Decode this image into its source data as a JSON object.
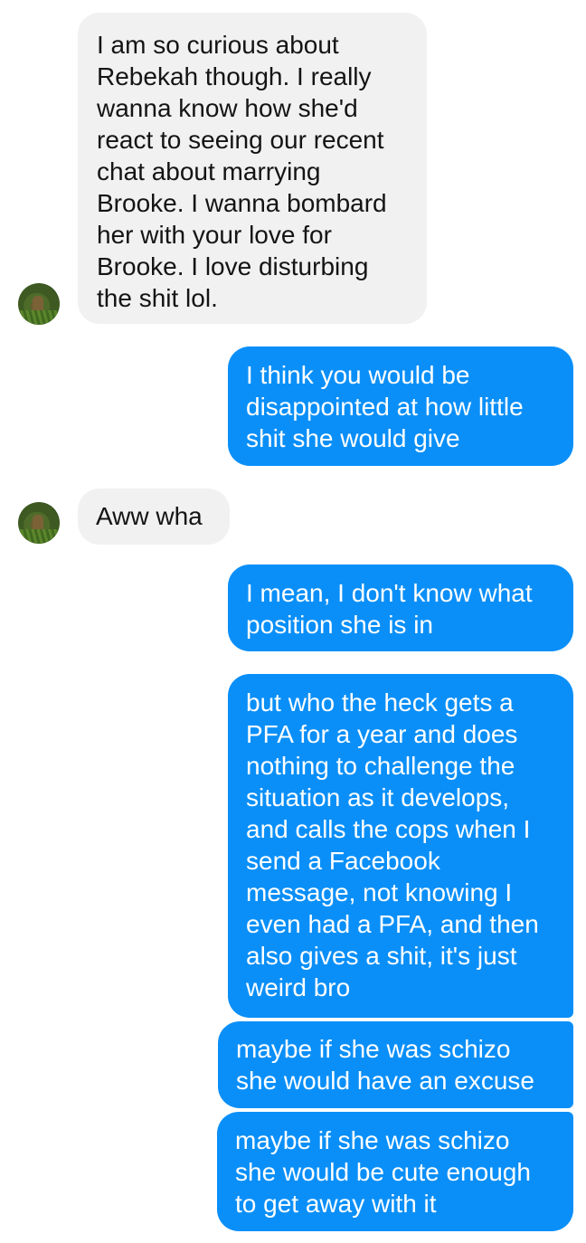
{
  "colors": {
    "incoming_bubble": "#f1f1f1",
    "outgoing_bubble": "#0a8ff8",
    "incoming_text": "#141414",
    "outgoing_text": "#ffffff"
  },
  "contact": {
    "avatar_icon": "contact-avatar-photo"
  },
  "messages": [
    {
      "sender": "contact",
      "text": "I am so curious about\nRebekah though. I really\nwanna know how she'd\nreact to seeing our recent\nchat about marrying\nBrooke. I wanna bombard\nher with your love for\nBrooke. I love disturbing\nthe shit lol."
    },
    {
      "sender": "me",
      "text": "I think you would be\ndisappointed at how little\nshit she would give"
    },
    {
      "sender": "contact",
      "text": "Aww wha"
    },
    {
      "sender": "me",
      "text": "I mean, I don't know what\nposition she is in"
    },
    {
      "sender": "me",
      "text": "but who the heck gets a\nPFA for a year and does\nnothing to challenge the\nsituation as it develops,\nand calls the cops when I\nsend a Facebook\nmessage, not knowing I\neven had a PFA, and then\nalso gives a shit, it's just\nweird bro"
    },
    {
      "sender": "me",
      "text": "maybe if she was schizo\nshe would have an excuse"
    },
    {
      "sender": "me",
      "text": "maybe if she was schizo\nshe would be cute enough\nto get away with it"
    }
  ]
}
